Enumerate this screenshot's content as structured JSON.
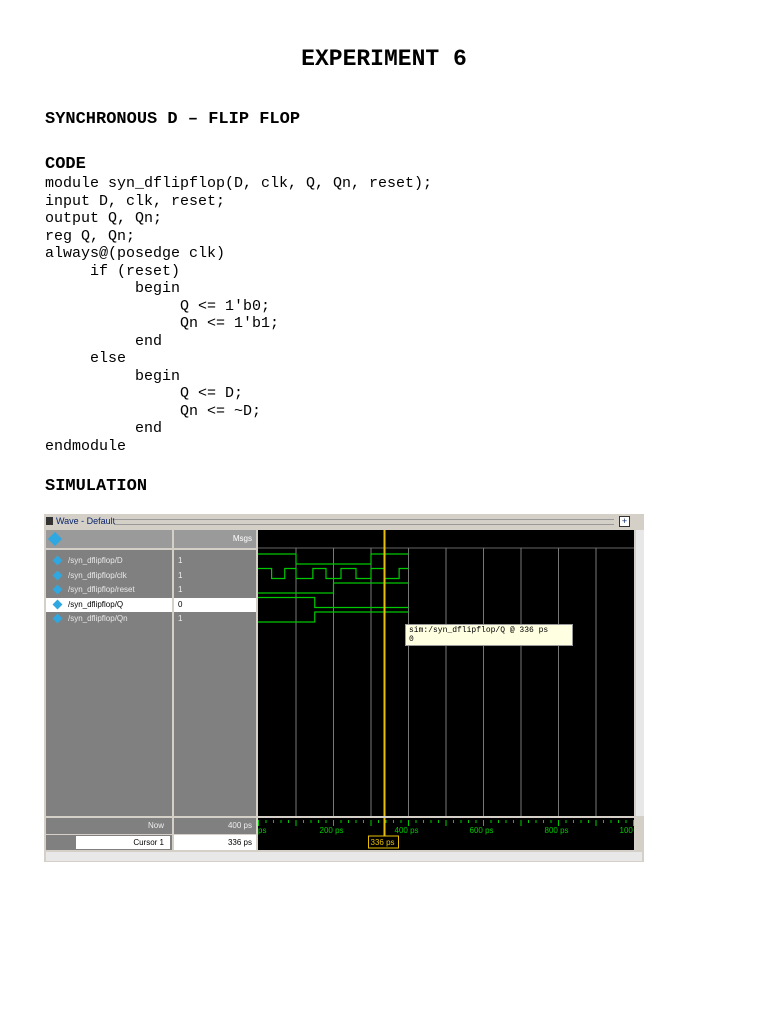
{
  "title": "EXPERIMENT 6",
  "heading": "SYNCHRONOUS D – FLIP FLOP",
  "code_label": "CODE",
  "code": "module syn_dflipflop(D, clk, Q, Qn, reset);\ninput D, clk, reset;\noutput Q, Qn;\nreg Q, Qn;\nalways@(posedge clk)\n     if (reset)\n          begin\n               Q <= 1'b0;\n               Qn <= 1'b1;\n          end\n     else\n          begin\n               Q <= D;\n               Qn <= ~D;\n          end\nendmodule",
  "simulation_label": "SIMULATION",
  "wave": {
    "window_title": "Wave - Default",
    "msgs_header": "Msgs",
    "signals": [
      {
        "name": "/syn_dflipflop/D",
        "value": "1",
        "init": 1,
        "edges": [
          100,
          300
        ]
      },
      {
        "name": "/syn_dflipflop/clk",
        "value": "1",
        "init": 1,
        "edges": [
          35,
          70,
          100,
          145,
          180,
          220,
          260,
          300,
          335,
          375
        ]
      },
      {
        "name": "/syn_dflipflop/reset",
        "value": "1",
        "init": 0,
        "edges": [
          200
        ]
      },
      {
        "name": "/syn_dflipflop/Q",
        "value": "0",
        "init": 1,
        "edges": [
          150
        ],
        "selected": true
      },
      {
        "name": "/syn_dflipflop/Qn",
        "value": "1",
        "init": 0,
        "edges": [
          150
        ]
      }
    ],
    "sim_end_ps": 400,
    "view_range_ps": [
      0,
      1000
    ],
    "time_ticks": [
      "ps",
      "200 ps",
      "400 ps",
      "600 ps",
      "800 ps",
      "100"
    ],
    "now_label": "Now",
    "now_value": "400 ps",
    "cursor_label": "Cursor 1",
    "cursor_value": "336 ps",
    "cursor_ps": 336,
    "tooltip_line1": "sim:/syn_dflipflop/Q @ 336 ps",
    "tooltip_line2": "0",
    "wave_color": "#00c800",
    "cursor_color": "#e8c000"
  }
}
